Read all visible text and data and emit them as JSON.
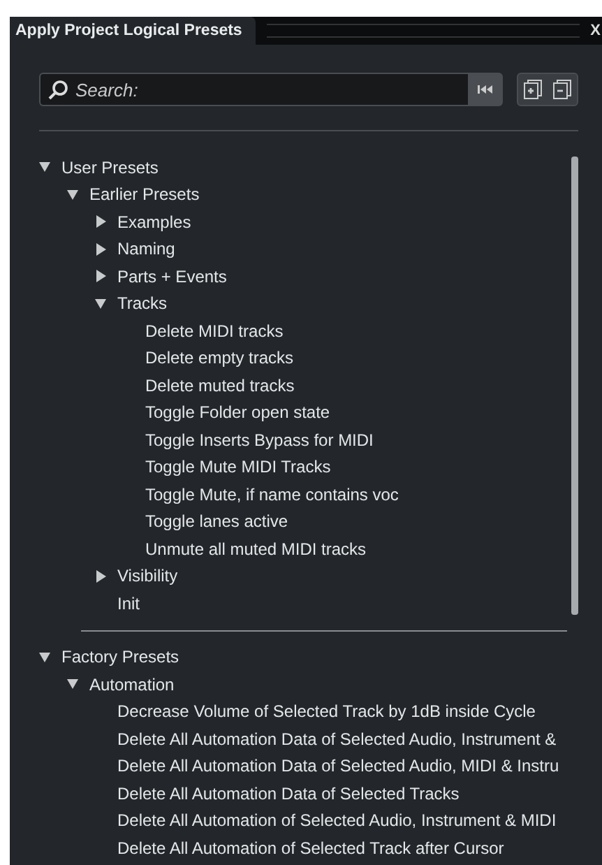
{
  "tab": {
    "label": "Apply Project Logical Presets",
    "selected": true
  },
  "close_label": "X",
  "search": {
    "placeholder": "Search:"
  },
  "tree": [
    {
      "label": "User Presets",
      "expanded": true,
      "children": [
        {
          "label": "Earlier Presets",
          "expanded": true,
          "children": [
            {
              "label": "Examples",
              "expanded": false
            },
            {
              "label": "Naming",
              "expanded": false
            },
            {
              "label": "Parts + Events",
              "expanded": false
            },
            {
              "label": "Tracks",
              "expanded": true,
              "children": [
                {
                  "label": "Delete MIDI tracks"
                },
                {
                  "label": "Delete empty tracks"
                },
                {
                  "label": "Delete muted  tracks"
                },
                {
                  "label": "Toggle Folder open state"
                },
                {
                  "label": "Toggle Inserts Bypass for MIDI"
                },
                {
                  "label": "Toggle Mute MIDI Tracks"
                },
                {
                  "label": "Toggle Mute, if name contains voc"
                },
                {
                  "label": "Toggle lanes active"
                },
                {
                  "label": "Unmute all muted MIDI tracks"
                }
              ]
            },
            {
              "label": "Visibility",
              "expanded": false
            },
            {
              "label": "Init"
            }
          ]
        }
      ]
    },
    {
      "label": "Factory Presets",
      "expanded": true,
      "children": [
        {
          "label": "Automation",
          "expanded": true,
          "children": [
            {
              "label": "Decrease Volume of Selected Track by 1dB inside Cycle"
            },
            {
              "label": "Delete All Automation Data of Selected Audio, Instrument &"
            },
            {
              "label": "Delete All Automation Data of Selected Audio, MIDI & Instru"
            },
            {
              "label": "Delete All Automation Data of Selected Tracks"
            },
            {
              "label": "Delete All Automation of Selected Audio, Instrument & MIDI"
            },
            {
              "label": "Delete All Automation of Selected Track after Cursor"
            }
          ]
        }
      ]
    }
  ]
}
